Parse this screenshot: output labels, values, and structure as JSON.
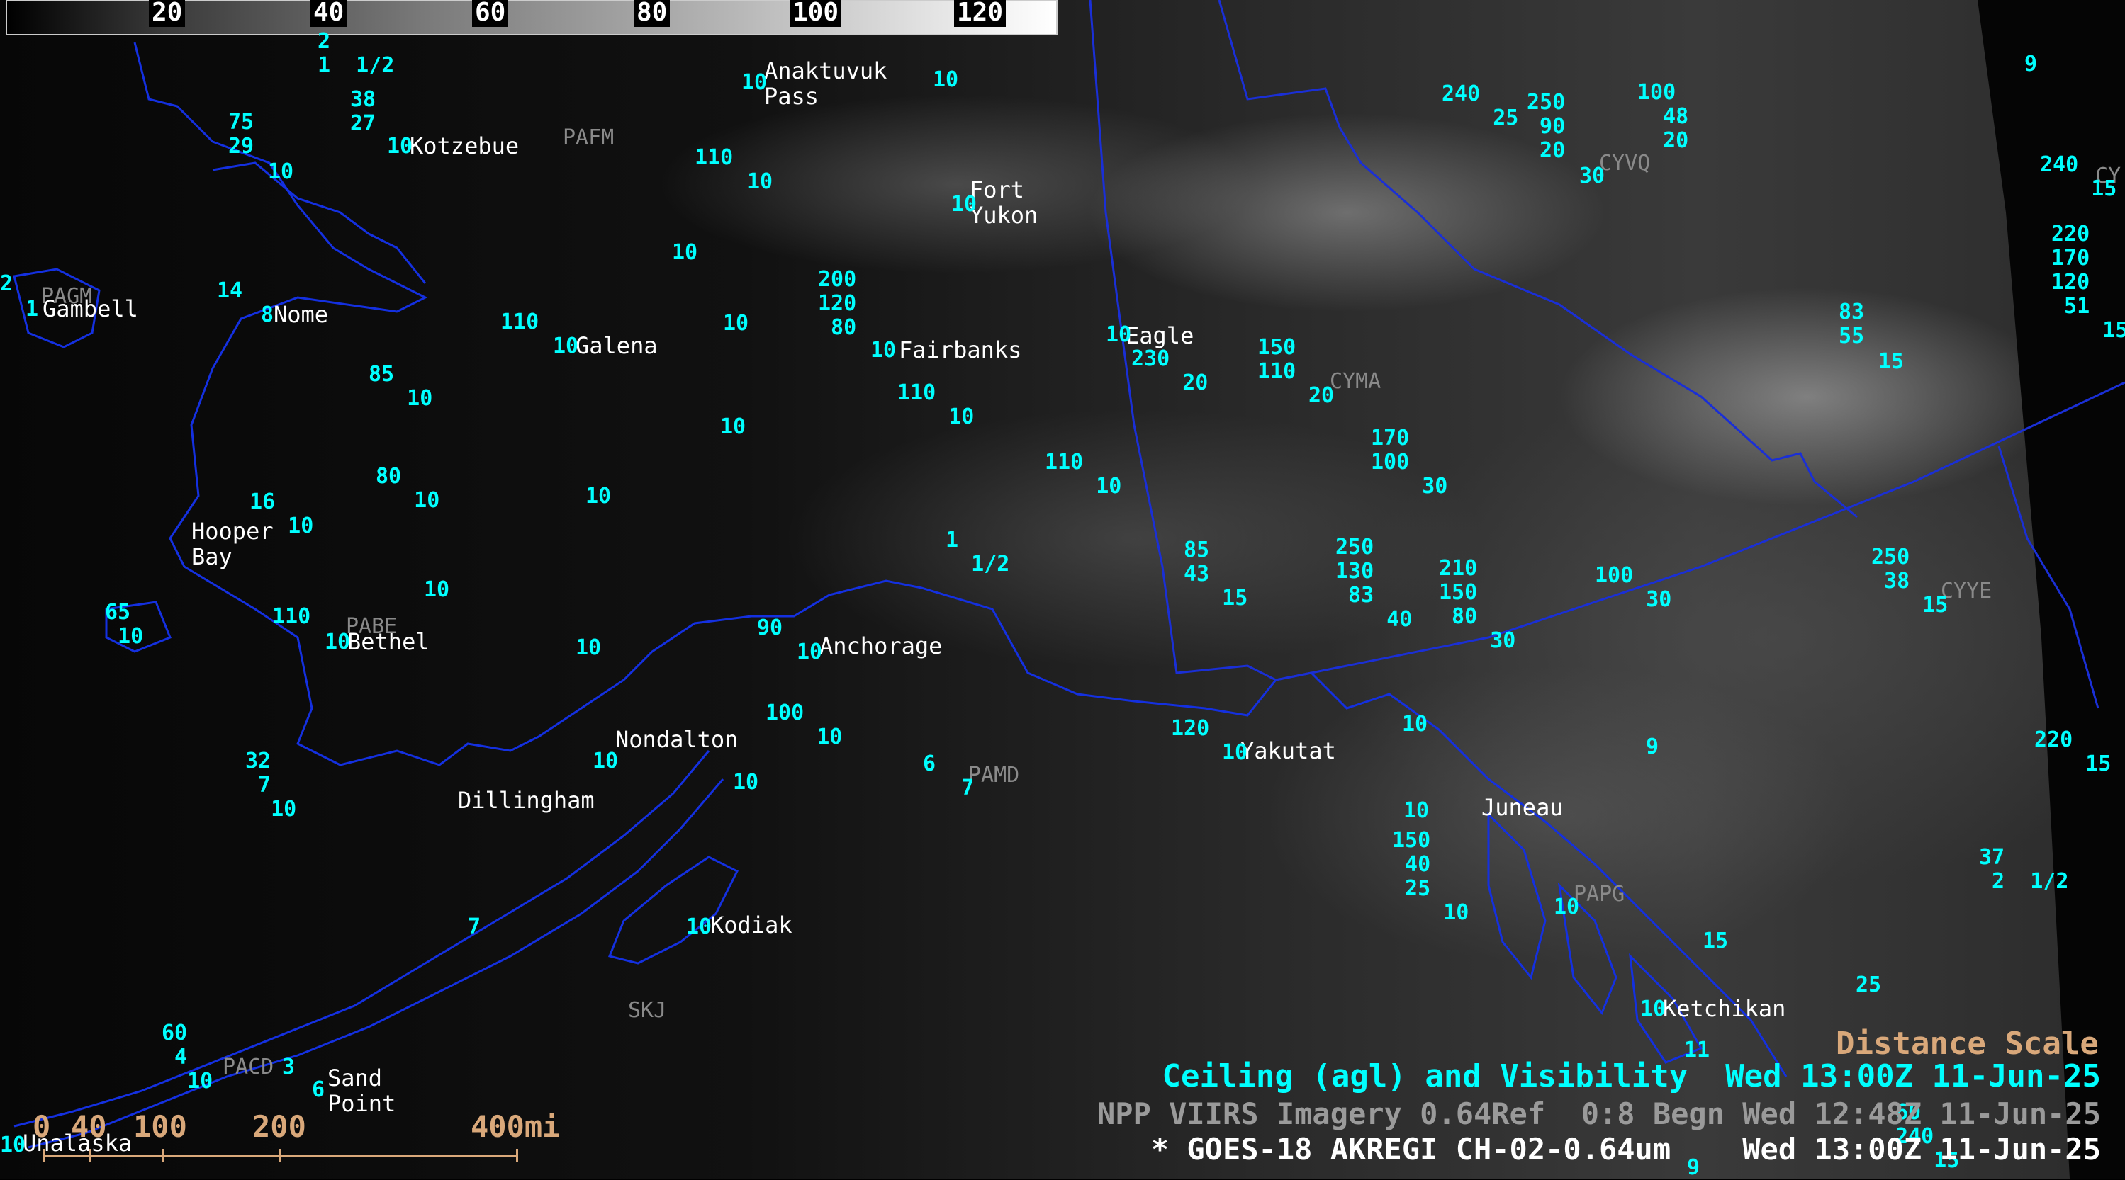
{
  "colorbar": {
    "ticks": [
      "20",
      "40",
      "60",
      "80",
      "100",
      "120"
    ]
  },
  "cities": [
    {
      "id": "anaktuvuk",
      "text": "Anaktuvuk\nPass"
    },
    {
      "id": "fort-yukon",
      "text": "Fort\nYukon"
    },
    {
      "id": "kotzebue",
      "text": "Kotzebue"
    },
    {
      "id": "gambell",
      "text": "Gambell"
    },
    {
      "id": "nome",
      "text": "Nome"
    },
    {
      "id": "galena",
      "text": "Galena"
    },
    {
      "id": "fairbanks",
      "text": "Fairbanks"
    },
    {
      "id": "eagle",
      "text": "Eagle"
    },
    {
      "id": "hooper-bay",
      "text": "Hooper\nBay"
    },
    {
      "id": "bethel",
      "text": "Bethel"
    },
    {
      "id": "anchorage",
      "text": "Anchorage"
    },
    {
      "id": "nondalton",
      "text": "Nondalton"
    },
    {
      "id": "dillingham",
      "text": "Dillingham"
    },
    {
      "id": "yakutat",
      "text": "Yakutat"
    },
    {
      "id": "juneau",
      "text": "Juneau"
    },
    {
      "id": "kodiak",
      "text": "Kodiak"
    },
    {
      "id": "ketchikan",
      "text": "Ketchikan"
    },
    {
      "id": "sand-point",
      "text": "Sand\nPoint"
    },
    {
      "id": "unalaska",
      "text": "Unalaska"
    }
  ],
  "identifiers": [
    "PAFM",
    "PAGM",
    "PABE",
    "PAMD",
    "PAPG",
    "PACD",
    "SKJ",
    "CYVQ",
    "CYMA",
    "CYYE",
    "CY"
  ],
  "stations": [
    {
      "id": "s1",
      "text": "2\n1  1/2"
    },
    {
      "id": "s2",
      "text": "38\n27"
    },
    {
      "id": "s3",
      "text": "10"
    },
    {
      "id": "s4",
      "text": "75\n29"
    },
    {
      "id": "s5",
      "text": "10"
    },
    {
      "id": "s6",
      "text": "10"
    },
    {
      "id": "s7",
      "text": "10"
    },
    {
      "id": "s8",
      "text": "110"
    },
    {
      "id": "s9",
      "text": "10"
    },
    {
      "id": "s10",
      "text": "10"
    },
    {
      "id": "s11",
      "text": "10"
    },
    {
      "id": "s12",
      "text": "240\n    25"
    },
    {
      "id": "s13",
      "text": "250\n 90\n 20"
    },
    {
      "id": "s14",
      "text": "30"
    },
    {
      "id": "s15",
      "text": "100\n  48\n  20"
    },
    {
      "id": "s16",
      "text": "9"
    },
    {
      "id": "s17",
      "text": "240\n    15"
    },
    {
      "id": "s18",
      "text": "2"
    },
    {
      "id": "s19",
      "text": "1"
    },
    {
      "id": "s20",
      "text": "14"
    },
    {
      "id": "s21",
      "text": "8"
    },
    {
      "id": "s22",
      "text": "110"
    },
    {
      "id": "s23",
      "text": "10"
    },
    {
      "id": "s24",
      "text": "10"
    },
    {
      "id": "s25",
      "text": "200\n120\n 80"
    },
    {
      "id": "s26",
      "text": "10"
    },
    {
      "id": "s27",
      "text": "10"
    },
    {
      "id": "s28",
      "text": "230\n    20"
    },
    {
      "id": "s29",
      "text": "150\n110"
    },
    {
      "id": "s30",
      "text": "20"
    },
    {
      "id": "s31",
      "text": "220\n170\n120\n 51\n    15"
    },
    {
      "id": "s32",
      "text": "83\n55"
    },
    {
      "id": "s33",
      "text": "15"
    },
    {
      "id": "s34",
      "text": "85\n   10"
    },
    {
      "id": "s35",
      "text": "110\n    10"
    },
    {
      "id": "s36",
      "text": "10"
    },
    {
      "id": "s37",
      "text": "170\n100\n    30"
    },
    {
      "id": "s38",
      "text": "80\n   10"
    },
    {
      "id": "s39",
      "text": "10"
    },
    {
      "id": "s40",
      "text": "110\n    10"
    },
    {
      "id": "s41",
      "text": "16\n   10"
    },
    {
      "id": "s42",
      "text": "1\n  1/2"
    },
    {
      "id": "s43",
      "text": "85\n43\n   15"
    },
    {
      "id": "s44",
      "text": "250\n130\n 83\n    40"
    },
    {
      "id": "s45",
      "text": "210\n150\n 80\n    30"
    },
    {
      "id": "s46",
      "text": "100\n    30"
    },
    {
      "id": "s47",
      "text": "250\n 38\n    15"
    },
    {
      "id": "s48",
      "text": "10"
    },
    {
      "id": "s49",
      "text": "65\n 10"
    },
    {
      "id": "s50",
      "text": "110"
    },
    {
      "id": "s51",
      "text": "10"
    },
    {
      "id": "s52",
      "text": "10"
    },
    {
      "id": "s53",
      "text": "90"
    },
    {
      "id": "s54",
      "text": "10"
    },
    {
      "id": "s55",
      "text": "100\n    10"
    },
    {
      "id": "s56",
      "text": "10"
    },
    {
      "id": "s57",
      "text": "10"
    },
    {
      "id": "s58",
      "text": "6\n   7"
    },
    {
      "id": "s59",
      "text": "120"
    },
    {
      "id": "s60",
      "text": "10"
    },
    {
      "id": "s61",
      "text": "10"
    },
    {
      "id": "s62",
      "text": "9"
    },
    {
      "id": "s63",
      "text": "220\n    15"
    },
    {
      "id": "s64",
      "text": "32\n 7\n  10"
    },
    {
      "id": "s65",
      "text": "10"
    },
    {
      "id": "s66",
      "text": "150\n 40\n 25\n    10"
    },
    {
      "id": "s67",
      "text": "10"
    },
    {
      "id": "s68",
      "text": "37\n 2  1/2"
    },
    {
      "id": "s69",
      "text": "7"
    },
    {
      "id": "s70",
      "text": "10"
    },
    {
      "id": "s71",
      "text": "15"
    },
    {
      "id": "s72",
      "text": "25"
    },
    {
      "id": "s73",
      "text": "10"
    },
    {
      "id": "s74",
      "text": "60\n 4\n  10"
    },
    {
      "id": "s75",
      "text": "3"
    },
    {
      "id": "s76",
      "text": "6"
    },
    {
      "id": "s77",
      "text": "11"
    },
    {
      "id": "s78",
      "text": "10"
    },
    {
      "id": "s79",
      "text": "60\n240\n   15"
    },
    {
      "id": "s80",
      "text": "9"
    }
  ],
  "titles": {
    "line1": "Ceiling (agl) and Visibility  Wed 13:00Z 11-Jun-25",
    "line2": "NPP VIIRS Imagery 0.64Ref  0:8 Begn Wed 12:48Z 11-Jun-25",
    "line3": "* GOES-18 AKREGI CH-02-0.64um    Wed 13:00Z 11-Jun-25"
  },
  "distance_scale": {
    "title": "Distance Scale",
    "labels": [
      "0",
      "40",
      "100",
      "200",
      "400mi"
    ]
  },
  "colors": {
    "station": "#00ffff",
    "border": "#1a2fd6",
    "coast": "#1430e0",
    "scale": "#d9a87a"
  }
}
